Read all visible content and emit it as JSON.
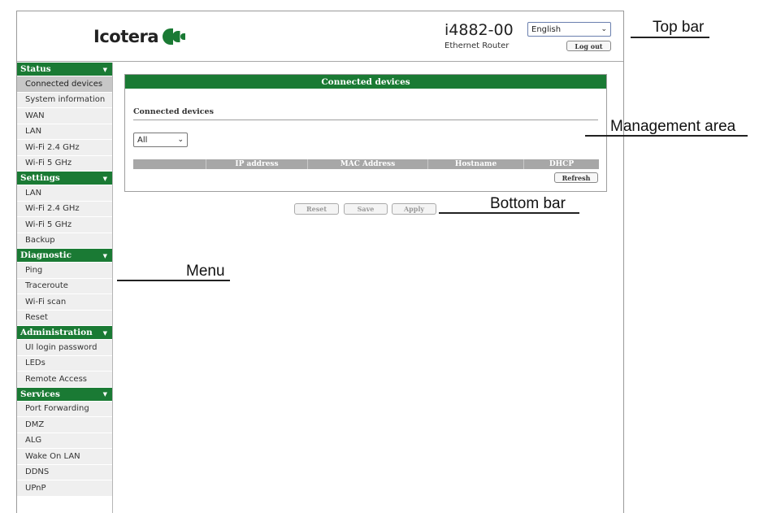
{
  "topbar": {
    "brand": "Icotera",
    "model": "i4882-00",
    "model_subtitle": "Ethernet Router",
    "language_selected": "English",
    "logout_label": "Log out"
  },
  "menu": {
    "sections": [
      {
        "title": "Status",
        "items": [
          "Connected devices",
          "System information",
          "WAN",
          "LAN",
          "Wi-Fi 2.4 GHz",
          "Wi-Fi 5 GHz"
        ]
      },
      {
        "title": "Settings",
        "items": [
          "LAN",
          "Wi-Fi 2.4 GHz",
          "Wi-Fi 5 GHz",
          "Backup"
        ]
      },
      {
        "title": "Diagnostic",
        "items": [
          "Ping",
          "Traceroute",
          "Wi-Fi scan",
          "Reset"
        ]
      },
      {
        "title": "Administration",
        "items": [
          "UI login password",
          "LEDs",
          "Remote Access"
        ]
      },
      {
        "title": "Services",
        "items": [
          "Port Forwarding",
          "DMZ",
          "ALG",
          "Wake On LAN",
          "DDNS",
          "UPnP"
        ]
      }
    ],
    "active_item": "Connected devices"
  },
  "main": {
    "panel_title": "Connected devices",
    "section_label": "Connected devices",
    "filter_selected": "All",
    "columns": [
      "",
      "IP address",
      "MAC Address",
      "Hostname",
      "DHCP"
    ],
    "refresh_label": "Refresh"
  },
  "bottom_bar": {
    "reset_label": "Reset",
    "save_label": "Save",
    "apply_label": "Apply"
  },
  "annotations": {
    "top_bar": "Top bar",
    "management_area": "Management area",
    "bottom_bar": "Bottom bar",
    "menu": "Menu"
  },
  "colors": {
    "brand_green": "#1a7a34",
    "active_item_bg": "#c7c7c7",
    "menu_item_bg": "#efefef",
    "table_header_bg": "#a7a7a7"
  },
  "icons": {
    "logo_mark": "icotera-logo-icon",
    "dropdown": "chevron-down-icon",
    "section_toggle": "triangle-down-icon"
  }
}
